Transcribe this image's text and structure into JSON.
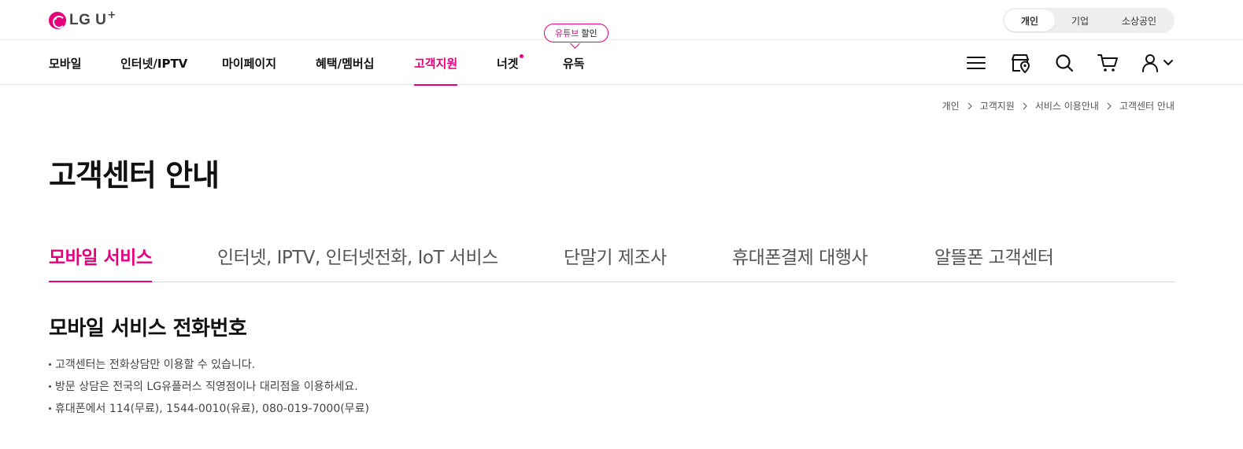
{
  "brand": {
    "name": "LG U",
    "plus": "+"
  },
  "customer_type": {
    "items": [
      "개인",
      "기업",
      "소상공인"
    ],
    "selected": "개인"
  },
  "promo_tooltip": {
    "highlight": "유튜브",
    "text": "할인"
  },
  "gnb": {
    "items": [
      "모바일",
      "인터넷/IPTV",
      "마이페이지",
      "혜택/멤버십",
      "고객지원",
      "너겟",
      "유독"
    ],
    "active": "고객지원"
  },
  "utility_icons": [
    "menu-icon",
    "store-location-icon",
    "search-icon",
    "cart-icon",
    "user-icon"
  ],
  "breadcrumb": [
    "개인",
    "고객지원",
    "서비스 이용안내",
    "고객센터 안내"
  ],
  "page_title": "고객센터 안내",
  "tabs": {
    "items": [
      "모바일 서비스",
      "인터넷, IPTV, 인터넷전화, IoT 서비스",
      "단말기 제조사",
      "휴대폰결제 대행사",
      "알뜰폰 고객센터"
    ],
    "active": "모바일 서비스"
  },
  "section": {
    "title": "모바일 서비스 전화번호",
    "bullets": [
      "고객센터는 전화상담만 이용할 수 있습니다.",
      "방문 상담은 전국의 LG유플러스 직영점이나 대리점을 이용하세요.",
      "휴대폰에서 114(무료), 1544-0010(유료), 080-019-7000(무료)"
    ]
  },
  "colors": {
    "accent": "#e6007e",
    "text": "#111111",
    "muted": "#555555"
  }
}
